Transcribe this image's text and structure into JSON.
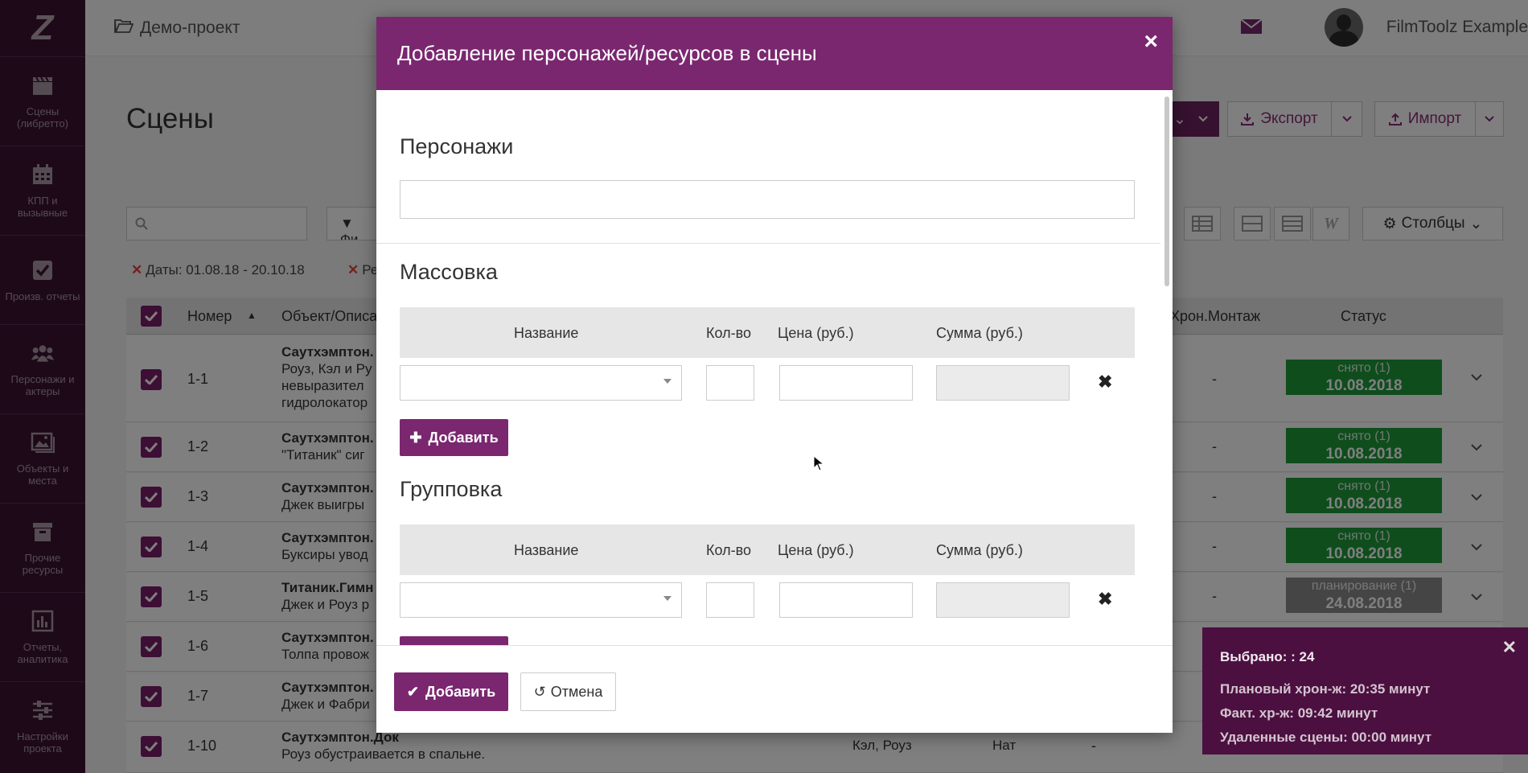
{
  "sidebar": {
    "logo": "Z",
    "items": [
      {
        "label": "Сцены (либретто)",
        "icon": "clapperboard-icon"
      },
      {
        "label": "КПП и вызывные",
        "icon": "calendar-icon"
      },
      {
        "label": "Произв. отчеты",
        "icon": "checkbox-icon"
      },
      {
        "label": "Персонажи и актеры",
        "icon": "people-icon"
      },
      {
        "label": "Объекты и места",
        "icon": "image-icon"
      },
      {
        "label": "Прочие ресурсы",
        "icon": "archive-icon"
      },
      {
        "label": "Отчеты, аналитика",
        "icon": "bar-chart-icon"
      },
      {
        "label": "Настройки проекта",
        "icon": "sliders-icon"
      }
    ]
  },
  "header": {
    "project": "Демо-проект",
    "username": "FilmToolz Example"
  },
  "page": {
    "title": "Сцены",
    "export_label": "Экспорт",
    "import_label": "Импорт",
    "filter_label": "Фи",
    "columns_label": "Столбцы",
    "chip_dates": "Даты: 01.08.18 - 20.10.18",
    "chip_other": "Ре"
  },
  "table": {
    "columns": {
      "number": "Номер",
      "object": "Объект/Описа",
      "montage": "Хрон.Монтаж",
      "status": "Статус"
    },
    "rows": [
      {
        "num": "1-1",
        "desc1": "Саутхэмптон.",
        "desc2": "Роуз, Кэл и Ру",
        "desc3": "невыразител",
        "desc4": "гидролокатор",
        "dash": "-",
        "status1": "снято (1)",
        "status2": "10.08.2018"
      },
      {
        "num": "1-2",
        "desc1": "Саутхэмптон.",
        "desc2": "\"Титаник\" сиг",
        "dash": "-",
        "status1": "снято (1)",
        "status2": "10.08.2018"
      },
      {
        "num": "1-3",
        "desc1": "Саутхэмптон.",
        "desc2": "Джек выигры",
        "dash": "-",
        "status1": "снято (1)",
        "status2": "10.08.2018"
      },
      {
        "num": "1-4",
        "desc1": "Саутхэмптон.",
        "desc2": "Буксиры увод",
        "dash": "-",
        "status1": "снято (1)",
        "status2": "10.08.2018"
      },
      {
        "num": "1-5",
        "desc1": "Титаник.Гимн",
        "desc2": "Джек и Роуз р",
        "dash": "-",
        "status1": "планирование (1)",
        "status2": "24.08.2018"
      },
      {
        "num": "1-6",
        "desc1": "Саутхэмптон.",
        "desc2": "Толпа провож"
      },
      {
        "num": "1-7",
        "desc1": "Саутхэмптон.",
        "desc2": "Джек и Фабри"
      },
      {
        "num": "1-10",
        "desc1": "Саутхэмптон.Док",
        "desc2": "Роуз обустраивается в спальне.",
        "cast": "Кэл, Роуз",
        "nat": "Нат",
        "dash": "-"
      }
    ]
  },
  "toast": {
    "selected": "Выбрано: : 24",
    "planned": "Плановый хрон-ж: 20:35 минут",
    "actual": "Факт. хр-ж: 09:42 минут",
    "deleted": "Удаленные сцены: 00:00 минут"
  },
  "modal": {
    "title": "Добавление персонажей/ресурсов в сцены",
    "characters_title": "Персонажи",
    "crowd_title": "Массовка",
    "group_title": "Групповка",
    "col_name": "Название",
    "col_qty": "Кол-во",
    "col_price": "Цена (руб.)",
    "col_sum": "Сумма (руб.)",
    "add_row_label": "Добавить",
    "submit_label": "Добавить",
    "cancel_label": "Отмена"
  },
  "colors": {
    "brand": "#7a276f",
    "sidebar": "#3d1233",
    "status_done": "#1e9b3a",
    "status_plan": "#8b8b8b"
  }
}
